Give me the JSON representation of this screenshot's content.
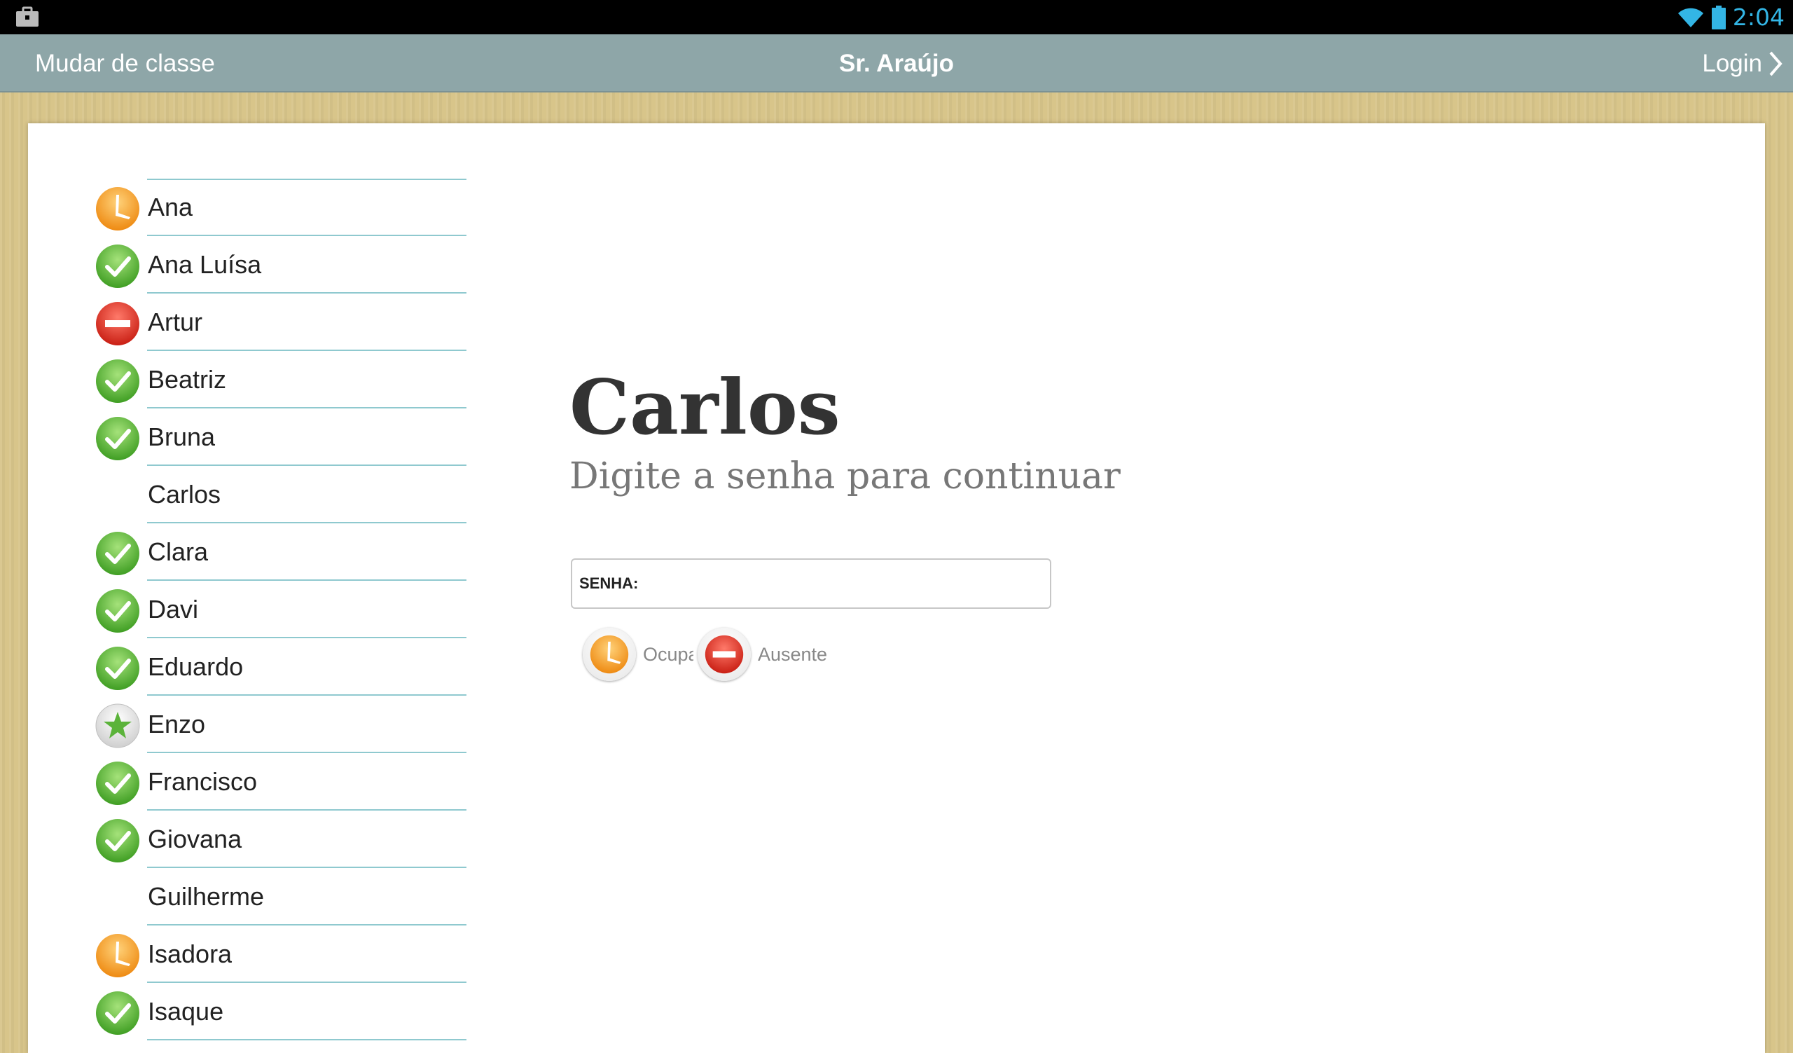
{
  "status_bar": {
    "time": "2:04",
    "left_icon": "briefcase-icon",
    "wifi_icon": "wifi-icon",
    "battery_icon": "battery-icon"
  },
  "app_bar": {
    "left_label": "Mudar de classe",
    "title": "Sr. Araújo",
    "right_label": "Login",
    "right_icon": "chevron-right-icon"
  },
  "students": [
    {
      "name": "Ana",
      "status": "busy"
    },
    {
      "name": "Ana Luísa",
      "status": "present"
    },
    {
      "name": "Artur",
      "status": "absent"
    },
    {
      "name": "Beatriz",
      "status": "present"
    },
    {
      "name": "Bruna",
      "status": "present"
    },
    {
      "name": "Carlos",
      "status": "none"
    },
    {
      "name": "Clara",
      "status": "present"
    },
    {
      "name": "Davi",
      "status": "present"
    },
    {
      "name": "Eduardo",
      "status": "present"
    },
    {
      "name": "Enzo",
      "status": "star"
    },
    {
      "name": "Francisco",
      "status": "present"
    },
    {
      "name": "Giovana",
      "status": "present"
    },
    {
      "name": "Guilherme",
      "status": "none"
    },
    {
      "name": "Isadora",
      "status": "busy"
    },
    {
      "name": "Isaque",
      "status": "present"
    }
  ],
  "main": {
    "selected_name": "Carlos",
    "prompt": "Digite a senha para continuar",
    "password_label": "SENHA:",
    "password_value": "",
    "status_options": [
      {
        "label": "Ocupa",
        "icon": "clock-icon"
      },
      {
        "label": "Ausente",
        "icon": "no-entry-icon"
      }
    ]
  },
  "colors": {
    "app_bar": "#8ea6a8",
    "wood": "#d8c58a",
    "divider": "#8fc9cf",
    "time": "#33b5e5",
    "present": "#6cc24a",
    "busy": "#f7a42a",
    "absent": "#e0362a"
  }
}
